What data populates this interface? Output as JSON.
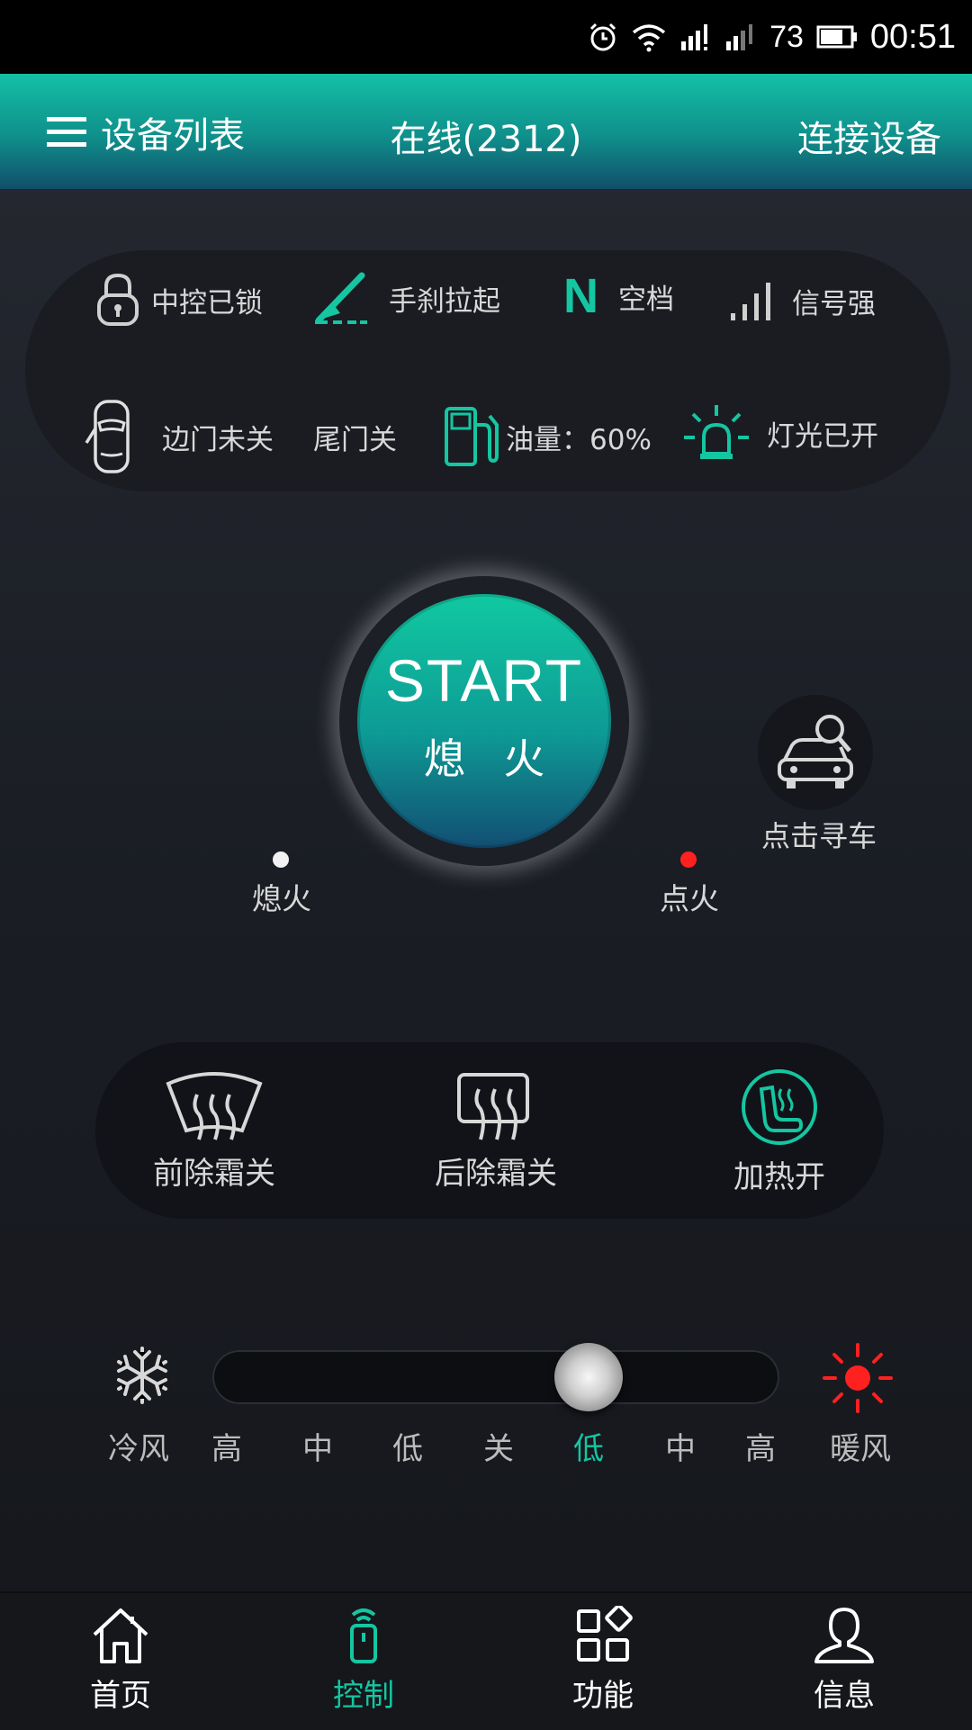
{
  "status_bar": {
    "battery": "73",
    "time": "00:51"
  },
  "header": {
    "menu_label": "设备列表",
    "title": "在线(2312)",
    "connect": "连接设备"
  },
  "status": {
    "lock": "中控已锁",
    "handbrake": "手刹拉起",
    "gear_symbol": "N",
    "gear": "空档",
    "signal": "信号强",
    "side_door": "边门未关",
    "tail_door": "尾门关",
    "fuel": "油量：60%",
    "lights": "灯光已开"
  },
  "engine": {
    "start_label": "START",
    "state_label": "熄 火",
    "off_label": "熄火",
    "on_label": "点火"
  },
  "find_car": {
    "label": "点击寻车"
  },
  "climate": {
    "front_defrost": "前除霜关",
    "rear_defrost": "后除霜关",
    "heating": "加热开"
  },
  "fan": {
    "cold_label": "冷风",
    "warm_label": "暖风",
    "scale": [
      "高",
      "中",
      "低",
      "关",
      "低",
      "中",
      "高"
    ],
    "selected": "低",
    "selected_index": 4
  },
  "colors": {
    "accent": "#14c6a2",
    "warm": "#ff2020",
    "indicator_on": "#ff2020"
  },
  "nav": [
    {
      "label": "首页",
      "icon": "home-icon"
    },
    {
      "label": "控制",
      "icon": "remote-icon"
    },
    {
      "label": "功能",
      "icon": "grid-icon"
    },
    {
      "label": "信息",
      "icon": "user-icon"
    }
  ]
}
